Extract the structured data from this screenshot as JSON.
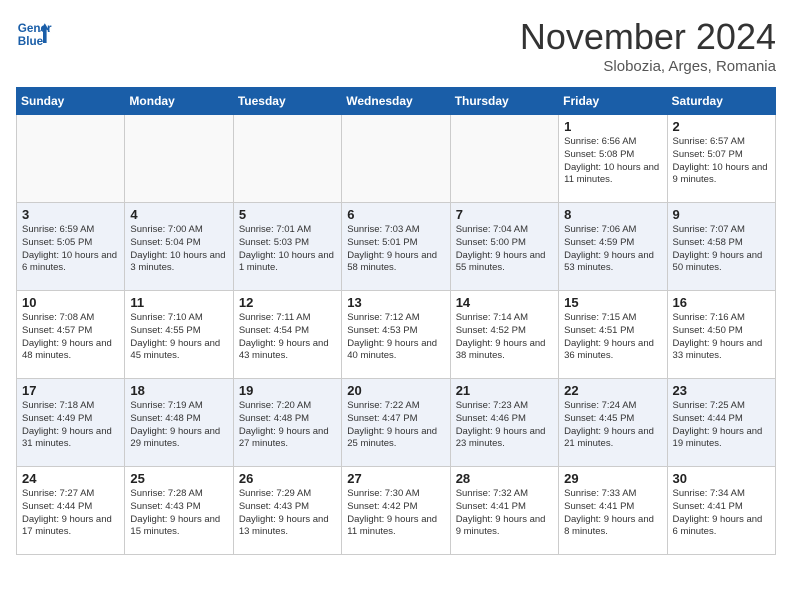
{
  "header": {
    "logo_line1": "General",
    "logo_line2": "Blue",
    "month": "November 2024",
    "location": "Slobozia, Arges, Romania"
  },
  "weekdays": [
    "Sunday",
    "Monday",
    "Tuesday",
    "Wednesday",
    "Thursday",
    "Friday",
    "Saturday"
  ],
  "weeks": [
    [
      {
        "day": "",
        "info": ""
      },
      {
        "day": "",
        "info": ""
      },
      {
        "day": "",
        "info": ""
      },
      {
        "day": "",
        "info": ""
      },
      {
        "day": "",
        "info": ""
      },
      {
        "day": "1",
        "info": "Sunrise: 6:56 AM\nSunset: 5:08 PM\nDaylight: 10 hours and 11 minutes."
      },
      {
        "day": "2",
        "info": "Sunrise: 6:57 AM\nSunset: 5:07 PM\nDaylight: 10 hours and 9 minutes."
      }
    ],
    [
      {
        "day": "3",
        "info": "Sunrise: 6:59 AM\nSunset: 5:05 PM\nDaylight: 10 hours and 6 minutes."
      },
      {
        "day": "4",
        "info": "Sunrise: 7:00 AM\nSunset: 5:04 PM\nDaylight: 10 hours and 3 minutes."
      },
      {
        "day": "5",
        "info": "Sunrise: 7:01 AM\nSunset: 5:03 PM\nDaylight: 10 hours and 1 minute."
      },
      {
        "day": "6",
        "info": "Sunrise: 7:03 AM\nSunset: 5:01 PM\nDaylight: 9 hours and 58 minutes."
      },
      {
        "day": "7",
        "info": "Sunrise: 7:04 AM\nSunset: 5:00 PM\nDaylight: 9 hours and 55 minutes."
      },
      {
        "day": "8",
        "info": "Sunrise: 7:06 AM\nSunset: 4:59 PM\nDaylight: 9 hours and 53 minutes."
      },
      {
        "day": "9",
        "info": "Sunrise: 7:07 AM\nSunset: 4:58 PM\nDaylight: 9 hours and 50 minutes."
      }
    ],
    [
      {
        "day": "10",
        "info": "Sunrise: 7:08 AM\nSunset: 4:57 PM\nDaylight: 9 hours and 48 minutes."
      },
      {
        "day": "11",
        "info": "Sunrise: 7:10 AM\nSunset: 4:55 PM\nDaylight: 9 hours and 45 minutes."
      },
      {
        "day": "12",
        "info": "Sunrise: 7:11 AM\nSunset: 4:54 PM\nDaylight: 9 hours and 43 minutes."
      },
      {
        "day": "13",
        "info": "Sunrise: 7:12 AM\nSunset: 4:53 PM\nDaylight: 9 hours and 40 minutes."
      },
      {
        "day": "14",
        "info": "Sunrise: 7:14 AM\nSunset: 4:52 PM\nDaylight: 9 hours and 38 minutes."
      },
      {
        "day": "15",
        "info": "Sunrise: 7:15 AM\nSunset: 4:51 PM\nDaylight: 9 hours and 36 minutes."
      },
      {
        "day": "16",
        "info": "Sunrise: 7:16 AM\nSunset: 4:50 PM\nDaylight: 9 hours and 33 minutes."
      }
    ],
    [
      {
        "day": "17",
        "info": "Sunrise: 7:18 AM\nSunset: 4:49 PM\nDaylight: 9 hours and 31 minutes."
      },
      {
        "day": "18",
        "info": "Sunrise: 7:19 AM\nSunset: 4:48 PM\nDaylight: 9 hours and 29 minutes."
      },
      {
        "day": "19",
        "info": "Sunrise: 7:20 AM\nSunset: 4:48 PM\nDaylight: 9 hours and 27 minutes."
      },
      {
        "day": "20",
        "info": "Sunrise: 7:22 AM\nSunset: 4:47 PM\nDaylight: 9 hours and 25 minutes."
      },
      {
        "day": "21",
        "info": "Sunrise: 7:23 AM\nSunset: 4:46 PM\nDaylight: 9 hours and 23 minutes."
      },
      {
        "day": "22",
        "info": "Sunrise: 7:24 AM\nSunset: 4:45 PM\nDaylight: 9 hours and 21 minutes."
      },
      {
        "day": "23",
        "info": "Sunrise: 7:25 AM\nSunset: 4:44 PM\nDaylight: 9 hours and 19 minutes."
      }
    ],
    [
      {
        "day": "24",
        "info": "Sunrise: 7:27 AM\nSunset: 4:44 PM\nDaylight: 9 hours and 17 minutes."
      },
      {
        "day": "25",
        "info": "Sunrise: 7:28 AM\nSunset: 4:43 PM\nDaylight: 9 hours and 15 minutes."
      },
      {
        "day": "26",
        "info": "Sunrise: 7:29 AM\nSunset: 4:43 PM\nDaylight: 9 hours and 13 minutes."
      },
      {
        "day": "27",
        "info": "Sunrise: 7:30 AM\nSunset: 4:42 PM\nDaylight: 9 hours and 11 minutes."
      },
      {
        "day": "28",
        "info": "Sunrise: 7:32 AM\nSunset: 4:41 PM\nDaylight: 9 hours and 9 minutes."
      },
      {
        "day": "29",
        "info": "Sunrise: 7:33 AM\nSunset: 4:41 PM\nDaylight: 9 hours and 8 minutes."
      },
      {
        "day": "30",
        "info": "Sunrise: 7:34 AM\nSunset: 4:41 PM\nDaylight: 9 hours and 6 minutes."
      }
    ]
  ]
}
